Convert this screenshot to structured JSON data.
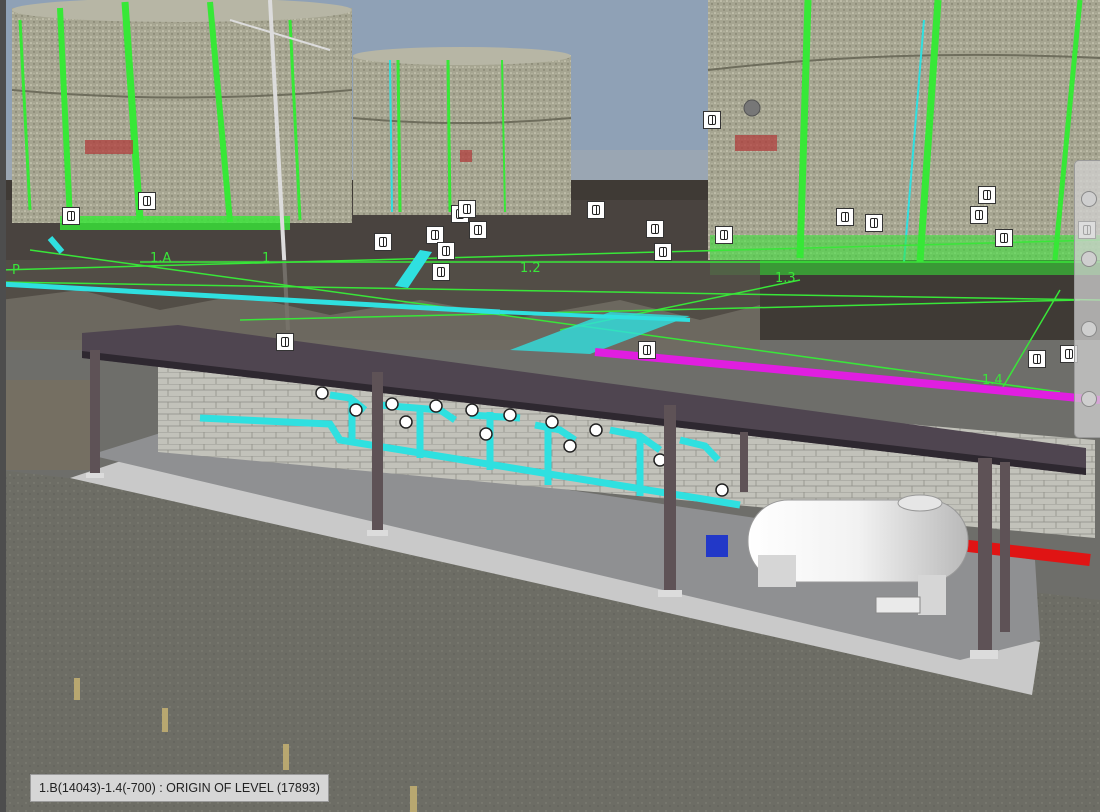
{
  "status_bar": {
    "text": "1.B(14043)-1.4(-700) : ORIGIN OF LEVEL (17893)"
  },
  "grid_labels": {
    "a": "1.A",
    "one": "1",
    "two": "1.2",
    "three": "1.3",
    "four": "1.4",
    "p": "P"
  },
  "side_toolbar": {
    "items": [
      "orbit-icon",
      "pan-icon",
      "zoom-icon",
      "look-icon"
    ]
  },
  "markers": {
    "count": 24,
    "icon": "view-cube-icon"
  },
  "colors": {
    "sky": "#8a9db3",
    "tank": "#9c9b85",
    "grid_line": "#39e639",
    "pipe_cyan": "#2fe0e0",
    "pipe_magenta": "#e01ee0",
    "pipe_red": "#e01414",
    "roof": "#4a3f4a",
    "wall": "#bdbdb5",
    "ground": "#6b6b63"
  }
}
